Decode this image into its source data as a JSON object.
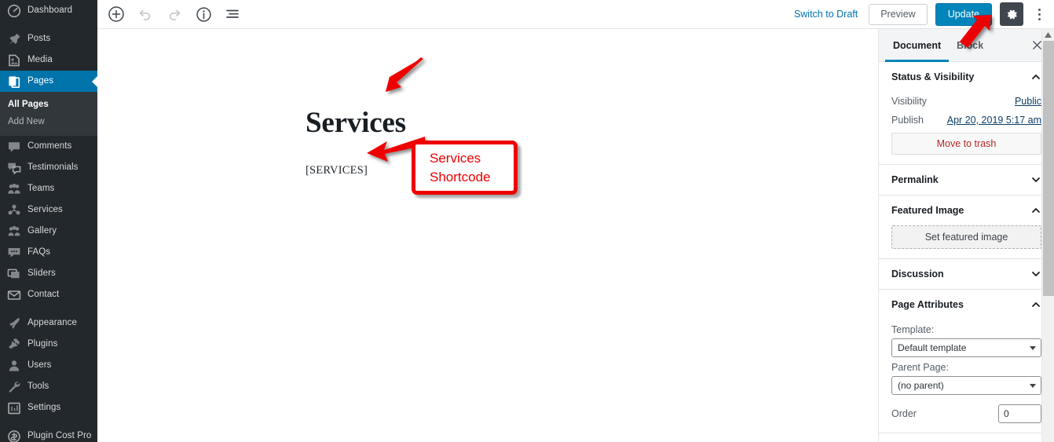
{
  "sidebar": {
    "items": [
      {
        "label": "Dashboard",
        "icon": "dashboard-icon",
        "current": false,
        "gap_before": false
      },
      {
        "label": "Posts",
        "icon": "pin-icon",
        "current": false,
        "gap_before": true
      },
      {
        "label": "Media",
        "icon": "media-icon",
        "current": false,
        "gap_before": false
      },
      {
        "label": "Pages",
        "icon": "pages-icon",
        "current": true,
        "gap_before": false
      },
      {
        "label": "Comments",
        "icon": "comment-icon",
        "current": false,
        "gap_before": false
      },
      {
        "label": "Testimonials",
        "icon": "testimonials-icon",
        "current": false,
        "gap_before": false
      },
      {
        "label": "Teams",
        "icon": "teams-icon",
        "current": false,
        "gap_before": false
      },
      {
        "label": "Services",
        "icon": "services-icon",
        "current": false,
        "gap_before": false
      },
      {
        "label": "Gallery",
        "icon": "gallery-icon",
        "current": false,
        "gap_before": false
      },
      {
        "label": "FAQs",
        "icon": "faqs-icon",
        "current": false,
        "gap_before": false
      },
      {
        "label": "Sliders",
        "icon": "sliders-icon",
        "current": false,
        "gap_before": false
      },
      {
        "label": "Contact",
        "icon": "contact-icon",
        "current": false,
        "gap_before": false
      },
      {
        "label": "Appearance",
        "icon": "appearance-icon",
        "current": false,
        "gap_before": true
      },
      {
        "label": "Plugins",
        "icon": "plugins-icon",
        "current": false,
        "gap_before": false
      },
      {
        "label": "Users",
        "icon": "users-icon",
        "current": false,
        "gap_before": false
      },
      {
        "label": "Tools",
        "icon": "tools-icon",
        "current": false,
        "gap_before": false
      },
      {
        "label": "Settings",
        "icon": "settings-icon",
        "current": false,
        "gap_before": false
      },
      {
        "label": "Plugin Cost Pro",
        "icon": "plugin-cost-icon",
        "current": false,
        "gap_before": true
      }
    ],
    "submenu": {
      "items": [
        {
          "label": "All Pages",
          "current": true
        },
        {
          "label": "Add New",
          "current": false
        }
      ]
    }
  },
  "header": {
    "tools": [
      {
        "name": "add-block-icon",
        "label": "Add block"
      },
      {
        "name": "undo-icon",
        "label": "Undo"
      },
      {
        "name": "redo-icon",
        "label": "Redo"
      },
      {
        "name": "info-icon",
        "label": "Content structure"
      },
      {
        "name": "block-navigation-icon",
        "label": "Block navigation"
      }
    ],
    "switch_to_draft": "Switch to Draft",
    "preview": "Preview",
    "update": "Update",
    "settings_icon": "gear-icon",
    "more_icon": "vertical-dots-icon"
  },
  "content": {
    "title": "Services",
    "shortcode": "[SERVICES]"
  },
  "annotations": {
    "color": "#ee0000",
    "callout": {
      "line1": "Services",
      "line2": "Shortcode"
    }
  },
  "settings": {
    "tabs": [
      {
        "label": "Document",
        "active": true
      },
      {
        "label": "Block",
        "active": false
      }
    ],
    "close_icon": "close-icon",
    "panels": {
      "status": {
        "title": "Status & Visibility",
        "expanded": true,
        "visibility_label": "Visibility",
        "visibility_value": "Public",
        "publish_label": "Publish",
        "publish_value": "Apr 20, 2019 5:17 am",
        "trash_label": "Move to trash"
      },
      "permalink": {
        "title": "Permalink",
        "expanded": false
      },
      "featured_image": {
        "title": "Featured Image",
        "expanded": true,
        "set_label": "Set featured image"
      },
      "discussion": {
        "title": "Discussion",
        "expanded": false
      },
      "page_attributes": {
        "title": "Page Attributes",
        "expanded": true,
        "template_label": "Template:",
        "template_value": "Default template",
        "parent_label": "Parent Page:",
        "parent_value": "(no parent)",
        "order_label": "Order",
        "order_value": "0"
      }
    }
  },
  "colors": {
    "admin_bg": "#23282d",
    "admin_current": "#0073aa",
    "update_blue": "#0085ba",
    "annotation_red": "#ee0000"
  }
}
